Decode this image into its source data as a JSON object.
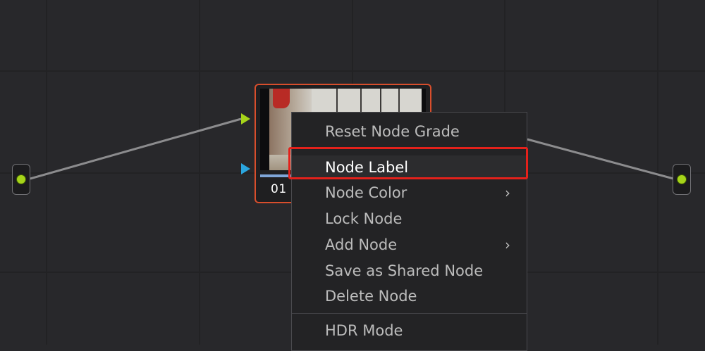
{
  "node": {
    "number": "01"
  },
  "context_menu": {
    "items": [
      {
        "label": "Reset Node Grade",
        "has_submenu": false
      },
      {
        "label": "Node Label",
        "has_submenu": false,
        "highlighted": true
      },
      {
        "label": "Node Color",
        "has_submenu": true
      },
      {
        "label": "Lock Node",
        "has_submenu": false
      },
      {
        "label": "Add Node",
        "has_submenu": true
      },
      {
        "label": "Save as Shared Node",
        "has_submenu": false
      },
      {
        "label": "Delete Node",
        "has_submenu": false
      },
      {
        "label": "HDR Mode",
        "has_submenu": false
      }
    ],
    "submenu_glyph": "›"
  },
  "colors": {
    "background": "#28282b",
    "node_border": "#d84e2c",
    "port_green": "#a6d41a",
    "port_blue": "#2ba6df",
    "annotation_red": "#e4211b"
  },
  "icons": {
    "rgb_input": "triangle-right-green",
    "key_input": "triangle-right-blue",
    "submenu": "chevron-right-icon"
  }
}
